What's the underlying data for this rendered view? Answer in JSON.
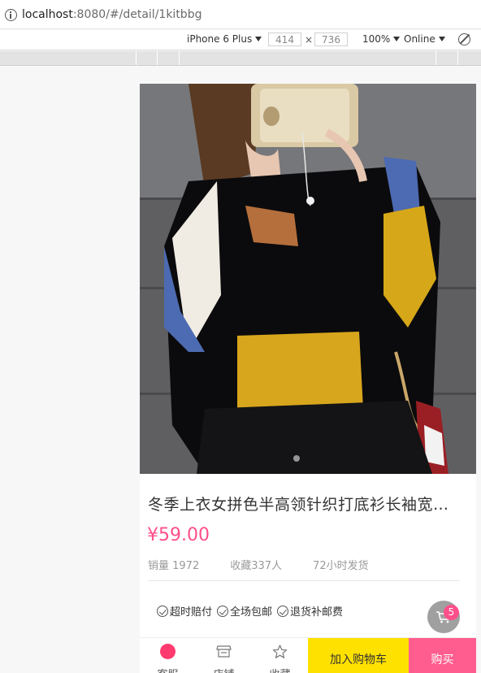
{
  "browser": {
    "url_host": "localhost",
    "url_rest": ":8080/#/detail/1kitbbg",
    "icons": {
      "info": "info-icon",
      "rotate": "rotate-icon"
    }
  },
  "device_toolbar": {
    "device": "iPhone 6 Plus",
    "width": "414",
    "height": "736",
    "separator": "×",
    "zoom": "100%",
    "network": "Online"
  },
  "product": {
    "image_alt": "product-photo",
    "carousel_dots": 1,
    "title": "冬季上衣女拼色半高领针织打底衫长袖宽松毛衣",
    "price": "¥59.00",
    "sales": "销量 1972",
    "favorites": "收藏337人",
    "shipping": "72小时发货",
    "perks": [
      "超时赔付",
      "全场包邮",
      "退货补邮费"
    ]
  },
  "cart_fab": {
    "icon": "cart-icon",
    "count": "5"
  },
  "tabbar": {
    "service_label": "客服",
    "store_label": "店铺",
    "favorite_label": "收藏",
    "add_to_cart_label": "加入购物车",
    "buy_label": "购买"
  },
  "colors": {
    "accent_pink": "#ff4f8b",
    "cart_button": "#ffe100",
    "buy_button": "#ff5d8f",
    "service_icon": "#ff3a6e"
  }
}
